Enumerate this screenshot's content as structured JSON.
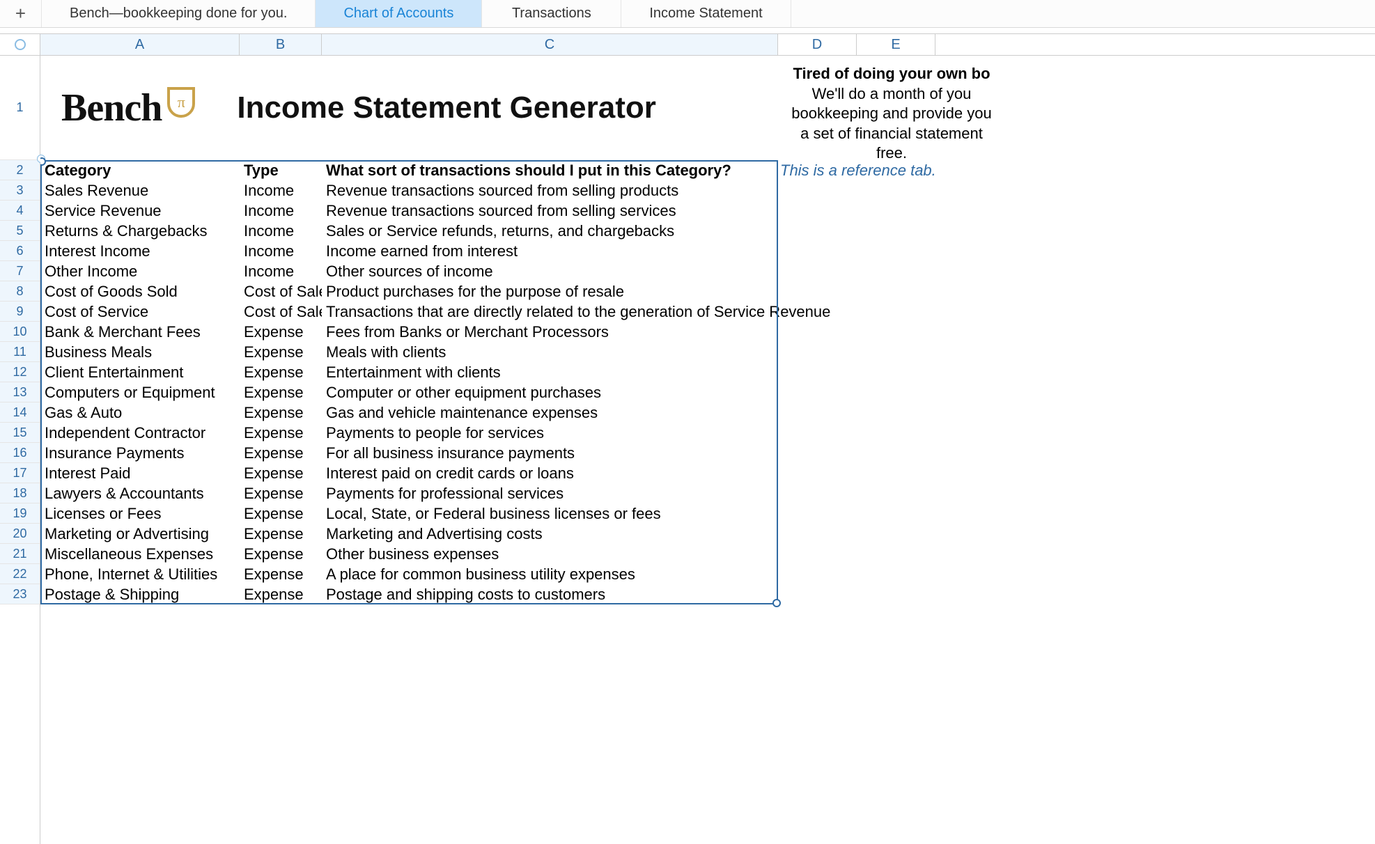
{
  "tabs": {
    "add_glyph": "+",
    "items": [
      {
        "label": "Bench—bookkeeping done for you.",
        "active": false,
        "wide": true
      },
      {
        "label": "Chart of Accounts",
        "active": true,
        "wide": false
      },
      {
        "label": "Transactions",
        "active": false,
        "wide": false
      },
      {
        "label": "Income Statement",
        "active": false,
        "wide": false
      }
    ]
  },
  "columns": [
    "A",
    "B",
    "C",
    "D",
    "E"
  ],
  "row_numbers": [
    "1",
    "2",
    "3",
    "4",
    "5",
    "6",
    "7",
    "8",
    "9",
    "10",
    "11",
    "12",
    "13",
    "14",
    "15",
    "16",
    "17",
    "18",
    "19",
    "20",
    "21",
    "22",
    "23"
  ],
  "header": {
    "brand_word": "Bench",
    "brand_badge_glyph": "π",
    "title": "Income Statement Generator"
  },
  "promo": {
    "line1_bold": "Tired of doing your own bo",
    "line2": "We'll do a month of you",
    "line3": "bookkeeping and provide you",
    "line4": "a set of financial statement",
    "line5": "free.",
    "side_note": "This is a reference tab."
  },
  "table": {
    "header": {
      "category": "Category",
      "type": "Type",
      "desc": "What sort of transactions should I put in this Category?"
    },
    "rows": [
      {
        "category": "Sales Revenue",
        "type": "Income",
        "desc": "Revenue transactions sourced from selling products"
      },
      {
        "category": "Service Revenue",
        "type": "Income",
        "desc": "Revenue transactions sourced from selling services"
      },
      {
        "category": "Returns & Chargebacks",
        "type": "Income",
        "desc": "Sales or Service refunds, returns, and chargebacks"
      },
      {
        "category": "Interest Income",
        "type": "Income",
        "desc": "Income earned from interest"
      },
      {
        "category": "Other Income",
        "type": "Income",
        "desc": "Other sources of income"
      },
      {
        "category": "Cost of Goods Sold",
        "type": "Cost of Sales",
        "desc": "Product purchases for the purpose of resale"
      },
      {
        "category": "Cost of Service",
        "type": "Cost of Sales",
        "desc": "Transactions that are directly related to the generation of Service Revenue"
      },
      {
        "category": "Bank & Merchant Fees",
        "type": "Expense",
        "desc": "Fees from Banks or Merchant Processors"
      },
      {
        "category": "Business Meals",
        "type": "Expense",
        "desc": "Meals with clients"
      },
      {
        "category": "Client Entertainment",
        "type": "Expense",
        "desc": "Entertainment with clients"
      },
      {
        "category": "Computers or Equipment",
        "type": "Expense",
        "desc": "Computer or other equipment purchases"
      },
      {
        "category": "Gas & Auto",
        "type": "Expense",
        "desc": "Gas and vehicle maintenance expenses"
      },
      {
        "category": "Independent Contractor",
        "type": "Expense",
        "desc": "Payments to people for services"
      },
      {
        "category": "Insurance Payments",
        "type": "Expense",
        "desc": "For all business insurance payments"
      },
      {
        "category": "Interest Paid",
        "type": "Expense",
        "desc": "Interest paid on credit cards or loans"
      },
      {
        "category": "Lawyers & Accountants",
        "type": "Expense",
        "desc": "Payments for professional services"
      },
      {
        "category": "Licenses or Fees",
        "type": "Expense",
        "desc": "Local, State, or Federal business licenses or fees"
      },
      {
        "category": "Marketing or Advertising",
        "type": "Expense",
        "desc": "Marketing and Advertising costs"
      },
      {
        "category": "Miscellaneous Expenses",
        "type": "Expense",
        "desc": "Other business expenses"
      },
      {
        "category": "Phone, Internet & Utilities",
        "type": "Expense",
        "desc": "A place for common business utility expenses"
      },
      {
        "category": "Postage & Shipping",
        "type": "Expense",
        "desc": "Postage and shipping costs to customers"
      }
    ]
  }
}
